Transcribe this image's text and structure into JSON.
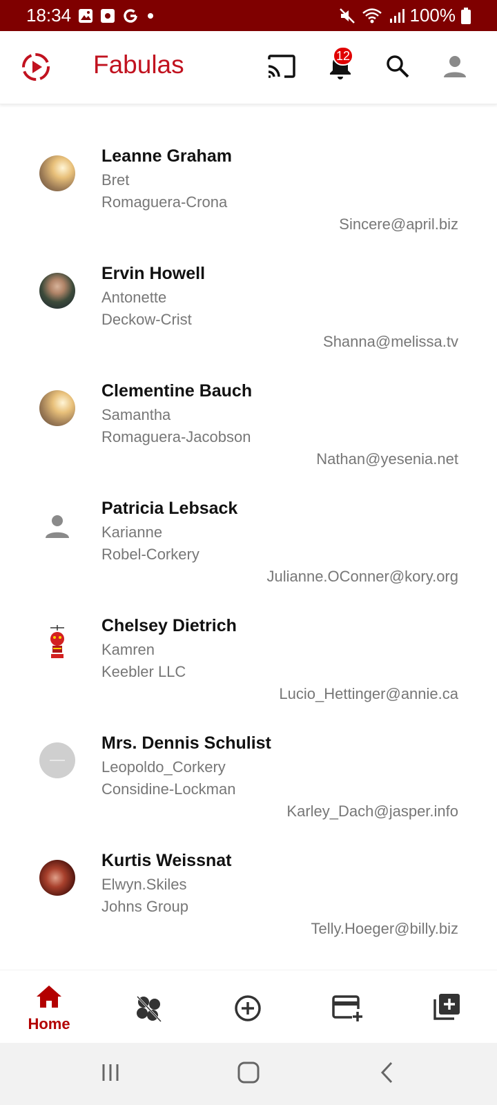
{
  "status_bar": {
    "time": "18:34",
    "battery": "100%",
    "left_icons": [
      "gallery-icon",
      "screen-record-icon",
      "google-icon",
      "dot-icon"
    ],
    "right_icons": [
      "mute-icon",
      "wifi-icon",
      "signal-icon",
      "battery-icon"
    ]
  },
  "app_bar": {
    "title": "Fabulas",
    "notification_count": "12",
    "accent_color": "#c1121f"
  },
  "users": [
    {
      "name": "Leanne Graham",
      "username": "Bret",
      "company": "Romaguera-Crona",
      "email": "Sincere@april.biz",
      "avatar": "sunlit-portrait-photo"
    },
    {
      "name": "Ervin Howell",
      "username": "Antonette",
      "company": "Deckow-Crist",
      "email": "Shanna@melissa.tv",
      "avatar": "man-portrait-photo"
    },
    {
      "name": "Clementine Bauch",
      "username": "Samantha",
      "company": "Romaguera-Jacobson",
      "email": "Nathan@yesenia.net",
      "avatar": "sunlit-portrait-photo"
    },
    {
      "name": "Patricia Lebsack",
      "username": "Karianne",
      "company": "Robel-Corkery",
      "email": "Julianne.OConner@kory.org",
      "avatar": "default-person-icon"
    },
    {
      "name": "Chelsey Dietrich",
      "username": "Kamren",
      "company": "Keebler LLC",
      "email": "Lucio_Hettinger@annie.ca",
      "avatar": "red-robot-illustration"
    },
    {
      "name": "Mrs. Dennis Schulist",
      "username": "Leopoldo_Corkery",
      "company": "Considine-Lockman",
      "email": "Karley_Dach@jasper.info",
      "avatar": "gray-placeholder"
    },
    {
      "name": "Kurtis Weissnat",
      "username": "Elwyn.Skiles",
      "company": "Johns Group",
      "email": "Telly.Hoeger@billy.biz",
      "avatar": "grilled-food-photo"
    }
  ],
  "bottom_nav": {
    "home_label": "Home",
    "items": [
      "home-icon",
      "clover-icon",
      "add-circle-icon",
      "add-card-icon",
      "add-box-icon"
    ]
  }
}
